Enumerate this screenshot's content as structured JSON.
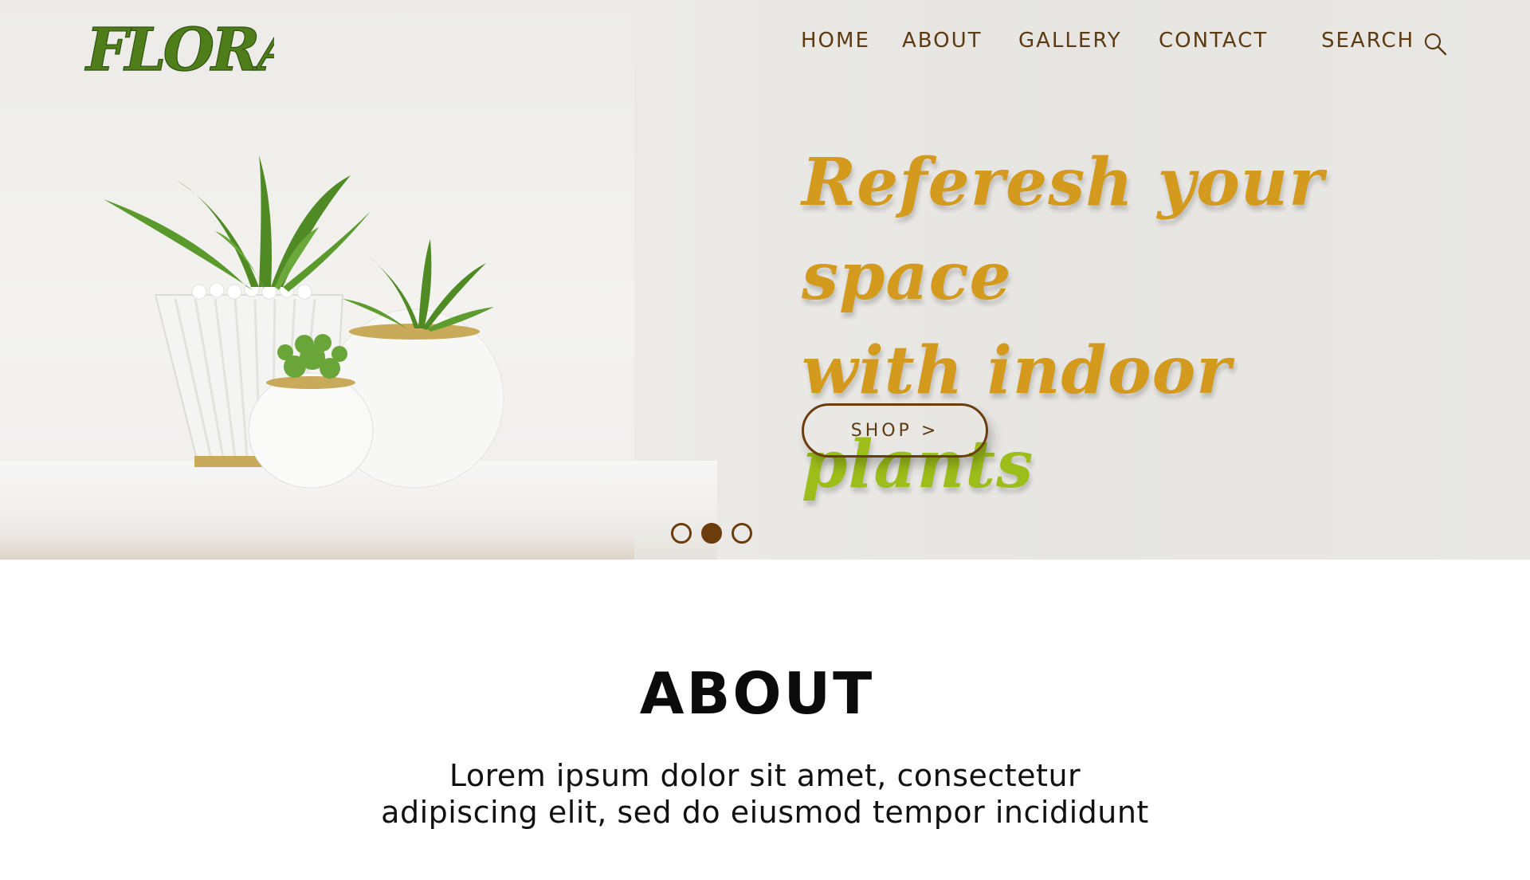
{
  "brand": {
    "logo_text": "FLORA",
    "logo_color": "#4e7d1a"
  },
  "nav": {
    "items": [
      {
        "label": "HOME"
      },
      {
        "label": "ABOUT"
      },
      {
        "label": "GALLERY"
      },
      {
        "label": "CONTACT"
      },
      {
        "label": "SEARCH"
      }
    ],
    "search_icon": "search-icon"
  },
  "hero": {
    "headline_line1": "Referesh your space",
    "headline_line2_prefix": "with indoor ",
    "headline_line2_accent": "plants",
    "shop_label": "SHOP >",
    "carousel": {
      "count": 3,
      "active_index": 1
    },
    "colors": {
      "headline": "#d39a1d",
      "accent": "#9cbd1a",
      "brown": "#6b3d0d"
    }
  },
  "about": {
    "title": "ABOUT",
    "line1": "Lorem ipsum dolor sit amet, consectetur",
    "line2": "adipiscing elit, sed do eiusmod tempor incididunt"
  }
}
